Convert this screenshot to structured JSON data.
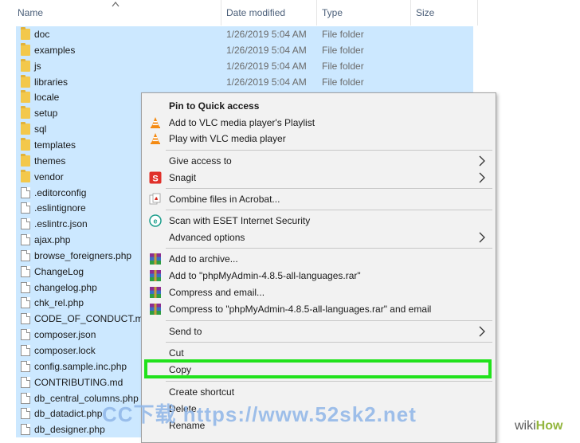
{
  "columns": {
    "name": "Name",
    "date": "Date modified",
    "type": "Type",
    "size": "Size"
  },
  "files": [
    {
      "name": "doc",
      "date": "1/26/2019 5:04 AM",
      "type": "File folder",
      "kind": "folder"
    },
    {
      "name": "examples",
      "date": "1/26/2019 5:04 AM",
      "type": "File folder",
      "kind": "folder"
    },
    {
      "name": "js",
      "date": "1/26/2019 5:04 AM",
      "type": "File folder",
      "kind": "folder"
    },
    {
      "name": "libraries",
      "date": "1/26/2019 5:04 AM",
      "type": "File folder",
      "kind": "folder"
    },
    {
      "name": "locale",
      "kind": "folder"
    },
    {
      "name": "setup",
      "kind": "folder"
    },
    {
      "name": "sql",
      "kind": "folder"
    },
    {
      "name": "templates",
      "kind": "folder"
    },
    {
      "name": "themes",
      "kind": "folder"
    },
    {
      "name": "vendor",
      "kind": "folder"
    },
    {
      "name": ".editorconfig",
      "kind": "file"
    },
    {
      "name": ".eslintignore",
      "kind": "file"
    },
    {
      "name": ".eslintrc.json",
      "kind": "file"
    },
    {
      "name": "ajax.php",
      "kind": "file"
    },
    {
      "name": "browse_foreigners.php",
      "kind": "file"
    },
    {
      "name": "ChangeLog",
      "kind": "file"
    },
    {
      "name": "changelog.php",
      "kind": "file"
    },
    {
      "name": "chk_rel.php",
      "kind": "file"
    },
    {
      "name": "CODE_OF_CONDUCT.md",
      "kind": "file"
    },
    {
      "name": "composer.json",
      "kind": "file"
    },
    {
      "name": "composer.lock",
      "kind": "file"
    },
    {
      "name": "config.sample.inc.php",
      "kind": "file"
    },
    {
      "name": "CONTRIBUTING.md",
      "kind": "file"
    },
    {
      "name": "db_central_columns.php",
      "kind": "file"
    },
    {
      "name": "db_datadict.php",
      "kind": "file"
    },
    {
      "name": "db_designer.php",
      "kind": "file"
    }
  ],
  "menu": {
    "pin": "Pin to Quick access",
    "vlc_add": "Add to VLC media player's Playlist",
    "vlc_play": "Play with VLC media player",
    "give_access": "Give access to",
    "snagit": "Snagit",
    "acrobat": "Combine files in Acrobat...",
    "eset_scan": "Scan with ESET Internet Security",
    "advanced": "Advanced options",
    "add_archive": "Add to archive...",
    "add_rar": "Add to \"phpMyAdmin-4.8.5-all-languages.rar\"",
    "compress_email": "Compress and email...",
    "compress_rar_email": "Compress to \"phpMyAdmin-4.8.5-all-languages.rar\" and email",
    "send_to": "Send to",
    "cut": "Cut",
    "copy": "Copy",
    "create_shortcut": "Create shortcut",
    "delete": "Delete",
    "rename": "Rename"
  },
  "watermark": "CC下载 https://www.52sk2.net",
  "wikihow": {
    "wiki": "wiki",
    "how": "How"
  },
  "colors": {
    "selection": "#cce8ff",
    "highlight": "#21e21c",
    "folder": "#f3c84b"
  }
}
